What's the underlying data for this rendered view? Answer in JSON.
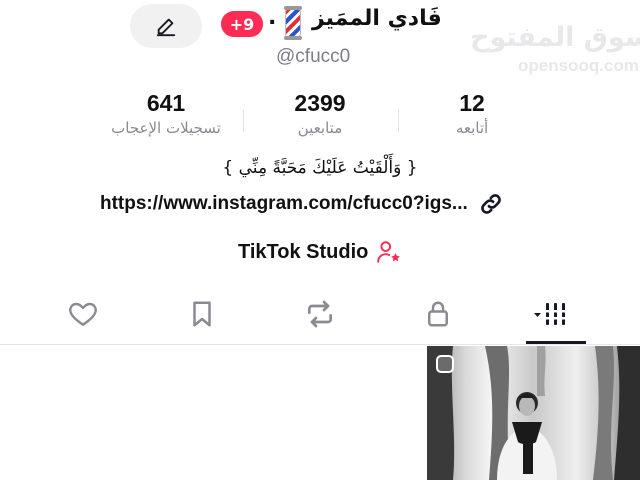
{
  "profile": {
    "display_name": "فَادي الممَيز",
    "separator": ".",
    "username": "@cfucc0",
    "notifications_badge": "+9",
    "edit_icon": "pencil-icon"
  },
  "watermark": {
    "arabic": "السوق المفتوح",
    "latin": "opensooq.com"
  },
  "stats": [
    {
      "value": "641",
      "label": "تسجيلات الإعجاب"
    },
    {
      "value": "2399",
      "label": "متابعين"
    },
    {
      "value": "12",
      "label": "أتابعه"
    }
  ],
  "bio": "{ وَأَلْقَيْتُ عَلَيْكَ مَحَبَّةً مِنِّي }",
  "link": {
    "text": "https://www.instagram.com/cfucc0?igs...",
    "icon": "link-icon"
  },
  "studio": {
    "label": "TikTok Studio",
    "icon": "person-star-icon"
  },
  "tabs": [
    {
      "name": "liked",
      "icon": "heart-icon"
    },
    {
      "name": "favorites",
      "icon": "bookmark-icon"
    },
    {
      "name": "reposts",
      "icon": "repost-icon"
    },
    {
      "name": "private",
      "icon": "lock-icon"
    },
    {
      "name": "videos",
      "icon": "grid-icon",
      "active": true
    }
  ],
  "colors": {
    "accent": "#fe2c55",
    "text": "#161823",
    "muted": "#8a8a92"
  }
}
